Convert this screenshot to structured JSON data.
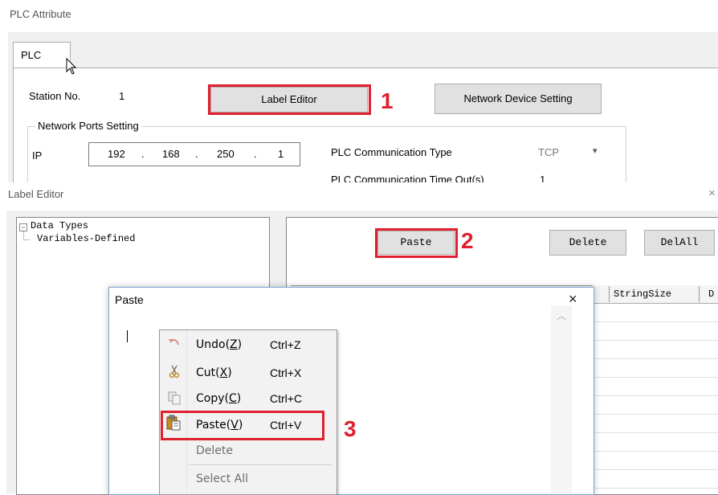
{
  "plc_window": {
    "title": "PLC Attribute",
    "tab": "PLC",
    "station_label": "Station No.",
    "station_value": "1",
    "label_editor_button": "Label Editor",
    "network_device_button": "Network Device Setting",
    "network_group_label": "Network Ports Setting",
    "ip_label": "IP",
    "ip_segments": [
      "192",
      "168",
      "250",
      "1"
    ],
    "ip_dots": [
      ".",
      ".",
      "."
    ],
    "comm_type_label": "PLC Communication Type",
    "comm_type_value": "TCP",
    "timeout_label": "PLC Communication Time Out(s)",
    "timeout_value": "1"
  },
  "label_editor": {
    "title": "Label Editor",
    "close_glyph": "×",
    "tree": {
      "expander": "−",
      "root": "Data Types",
      "child": "Variables-Defined"
    },
    "paste_button": "Paste",
    "delete_button": "Delete",
    "delall_button": "DelAll",
    "columns": [
      "StringSize",
      "D"
    ]
  },
  "paste_dialog": {
    "title": "Paste",
    "close_glyph": "×"
  },
  "context_menu": {
    "items": [
      {
        "label": "Undo(Z)",
        "shortcut": "Ctrl+Z",
        "icon": "undo-icon",
        "enabled": true
      },
      {
        "label": "Cut(X)",
        "shortcut": "Ctrl+X",
        "icon": "cut-icon",
        "enabled": true
      },
      {
        "label": "Copy(C)",
        "shortcut": "Ctrl+C",
        "icon": "copy-icon",
        "enabled": true
      },
      {
        "label": "Paste(V)",
        "shortcut": "Ctrl+V",
        "icon": "paste-icon",
        "enabled": true
      },
      {
        "label": "Delete",
        "shortcut": "",
        "icon": "",
        "enabled": false
      },
      {
        "label": "Select All",
        "shortcut": "",
        "icon": "",
        "enabled": false
      }
    ]
  },
  "annotations": {
    "callout_1": "1",
    "callout_2": "2",
    "callout_3": "3",
    "highlight_color": "#e0202e"
  }
}
